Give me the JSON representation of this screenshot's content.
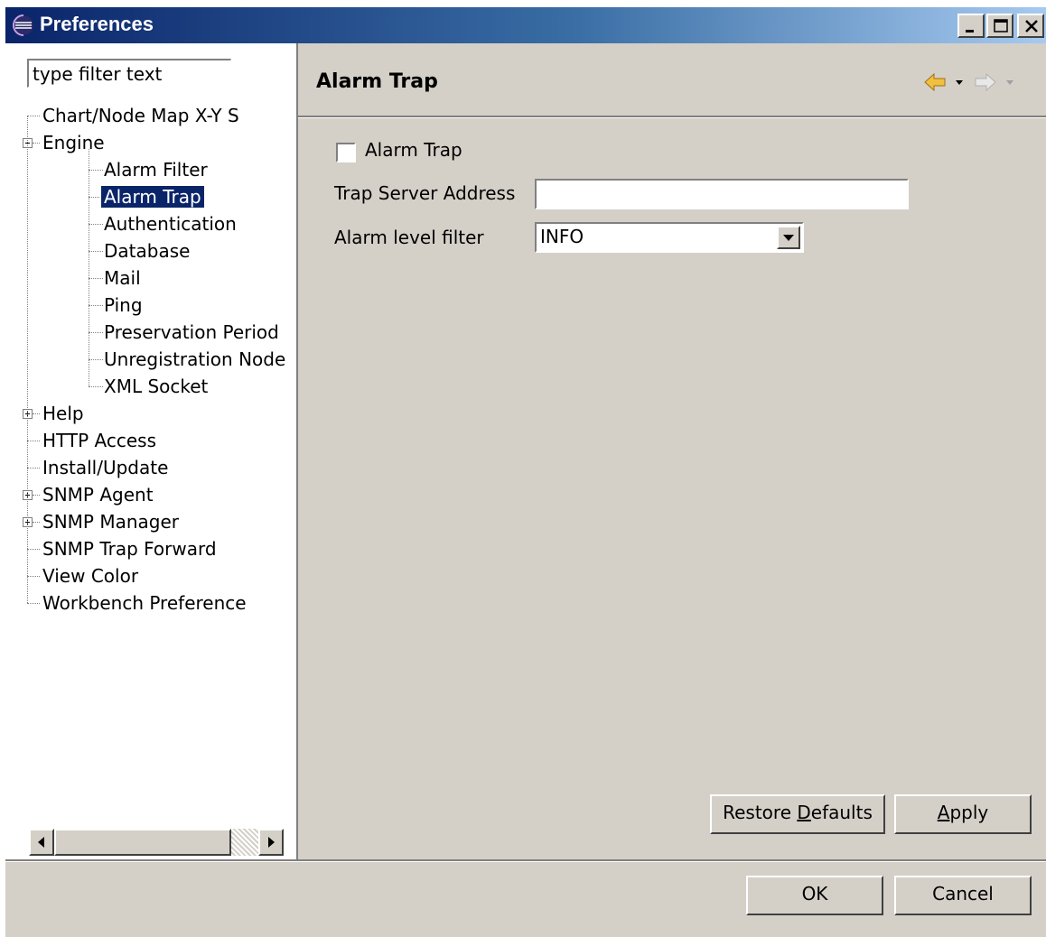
{
  "window": {
    "title": "Preferences"
  },
  "filter": {
    "placeholder": "type filter text",
    "value": "type filter text"
  },
  "tree": {
    "items": [
      {
        "label": "Chart/Node Map X-Y S",
        "level": 0,
        "expander": null
      },
      {
        "label": "Engine",
        "level": 0,
        "expander": "minus"
      },
      {
        "label": "Alarm Filter",
        "level": 1,
        "expander": null
      },
      {
        "label": "Alarm Trap",
        "level": 1,
        "expander": null,
        "selected": true
      },
      {
        "label": "Authentication",
        "level": 1,
        "expander": null
      },
      {
        "label": "Database",
        "level": 1,
        "expander": null
      },
      {
        "label": "Mail",
        "level": 1,
        "expander": null
      },
      {
        "label": "Ping",
        "level": 1,
        "expander": null
      },
      {
        "label": "Preservation Period",
        "level": 1,
        "expander": null
      },
      {
        "label": "Unregistration Node",
        "level": 1,
        "expander": null
      },
      {
        "label": "XML Socket",
        "level": 1,
        "expander": null
      },
      {
        "label": "Help",
        "level": 0,
        "expander": "plus"
      },
      {
        "label": "HTTP Access",
        "level": 0,
        "expander": null
      },
      {
        "label": "Install/Update",
        "level": 0,
        "expander": null
      },
      {
        "label": "SNMP Agent",
        "level": 0,
        "expander": "plus"
      },
      {
        "label": "SNMP Manager",
        "level": 0,
        "expander": "plus"
      },
      {
        "label": "SNMP Trap Forward",
        "level": 0,
        "expander": null
      },
      {
        "label": "View Color",
        "level": 0,
        "expander": null
      },
      {
        "label": "Workbench  Preference",
        "level": 0,
        "expander": null
      }
    ]
  },
  "page": {
    "title": "Alarm Trap",
    "alarm_trap_checkbox_label": "Alarm Trap",
    "alarm_trap_checked": false,
    "trap_server_address_label": "Trap Server Address",
    "trap_server_address_value": "",
    "alarm_level_filter_label": "Alarm level filter",
    "alarm_level_filter_value": "INFO"
  },
  "buttons": {
    "restore_defaults_pre": "Restore ",
    "restore_defaults_mnemonic": "D",
    "restore_defaults_post": "efaults",
    "apply_mnemonic": "A",
    "apply_post": "pply",
    "ok": "OK",
    "cancel": "Cancel"
  },
  "icons": {
    "window": "eclipse-icon",
    "back": "back-arrow-icon",
    "forward": "forward-arrow-icon"
  },
  "colors": {
    "titlebar_start": "#0a246a",
    "titlebar_end": "#a6caf0",
    "selection": "#0a246a",
    "back_arrow": "#f0c040"
  }
}
